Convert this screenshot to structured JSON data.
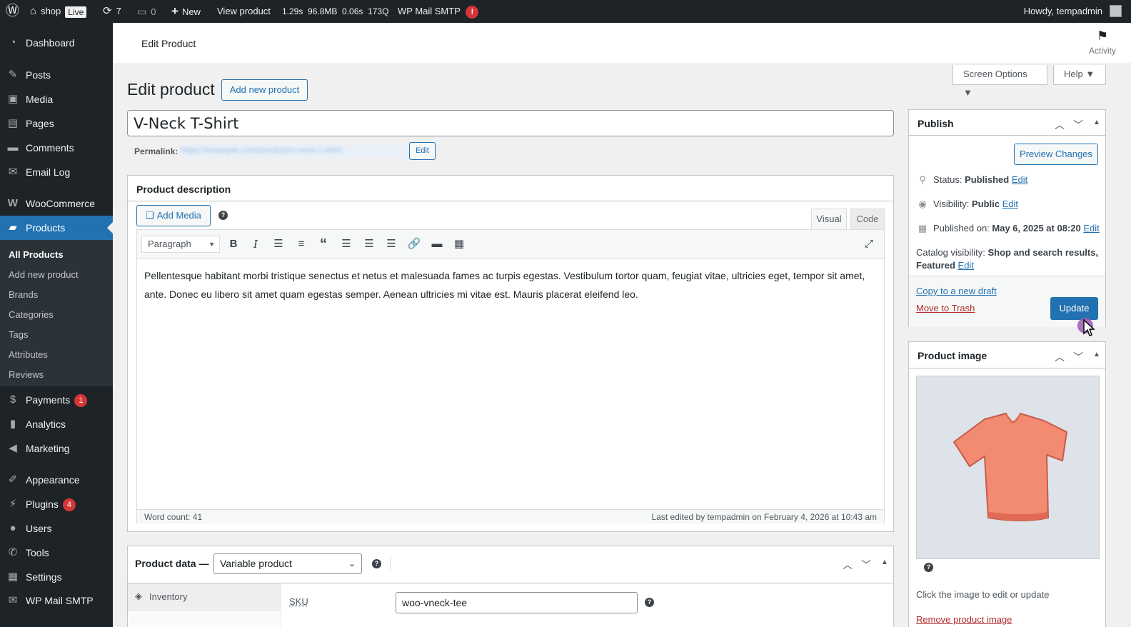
{
  "adminbar": {
    "site_name": "shop",
    "live_badge": "Live",
    "updates_count": "7",
    "comments_count": "0",
    "new_label": "New",
    "view_product": "View product",
    "perf": "1.29s  96.8MB  0.06s  173Q",
    "mail_smtp": "WP Mail SMTP",
    "mail_alert": "!",
    "howdy": "Howdy, tempadmin"
  },
  "sidebar": {
    "items": [
      {
        "label": "Dashboard",
        "icon": "dashboard-icon"
      },
      {
        "label": "Posts",
        "icon": "pin-icon"
      },
      {
        "label": "Media",
        "icon": "media-icon"
      },
      {
        "label": "Pages",
        "icon": "pages-icon"
      },
      {
        "label": "Comments",
        "icon": "comment-icon"
      },
      {
        "label": "Email Log",
        "icon": "envelope-icon"
      },
      {
        "label": "WooCommerce",
        "icon": "woo-icon"
      },
      {
        "label": "Products",
        "icon": "products-icon"
      },
      {
        "label": "Payments",
        "icon": "payments-icon",
        "badge": "1"
      },
      {
        "label": "Analytics",
        "icon": "analytics-icon"
      },
      {
        "label": "Marketing",
        "icon": "megaphone-icon"
      },
      {
        "label": "Appearance",
        "icon": "brush-icon"
      },
      {
        "label": "Plugins",
        "icon": "plug-icon",
        "badge": "4"
      },
      {
        "label": "Users",
        "icon": "user-icon"
      },
      {
        "label": "Tools",
        "icon": "wrench-icon"
      },
      {
        "label": "Settings",
        "icon": "settings-icon"
      },
      {
        "label": "WP Mail SMTP",
        "icon": "smtp-icon"
      }
    ],
    "submenu": [
      "All Products",
      "Add new product",
      "Brands",
      "Categories",
      "Tags",
      "Attributes",
      "Reviews"
    ]
  },
  "header": {
    "title": "Edit Product",
    "activity": "Activity",
    "screen_options": "Screen Options ▼",
    "help": "Help ▼"
  },
  "page": {
    "heading": "Edit product",
    "add_new": "Add new product",
    "product_title": "V-Neck T-Shirt",
    "permalink_label": "Permalink:",
    "permalink_url": "https://example.com/product/v-neck-t-shirt/",
    "permalink_edit": "Edit"
  },
  "description": {
    "title": "Product description",
    "add_media": "Add Media",
    "tab_visual": "Visual",
    "tab_code": "Code",
    "format": "Paragraph",
    "content": "Pellentesque habitant morbi tristique senectus et netus et malesuada fames ac turpis egestas. Vestibulum tortor quam, feugiat vitae, ultricies eget, tempor sit amet, ante. Donec eu libero sit amet quam egestas semper. Aenean ultricies mi vitae est. Mauris placerat eleifend leo.",
    "word_count": "Word count: 41",
    "last_edited": "Last edited by tempadmin on February 4, 2026 at 10:43 am"
  },
  "product_data": {
    "title": "Product data —",
    "type": "Variable product",
    "tab_inventory": "Inventory",
    "sku_label": "SKU",
    "sku_value": "woo-vneck-tee"
  },
  "publish": {
    "title": "Publish",
    "preview": "Preview Changes",
    "status_label": "Status:",
    "status_value": "Published",
    "visibility_label": "Visibility:",
    "visibility_value": "Public",
    "published_label": "Published on:",
    "published_value": "May 6, 2025 at 08:20",
    "catalog_label": "Catalog visibility:",
    "catalog_value": "Shop and search results, Featured",
    "edit": "Edit",
    "copy_draft": "Copy to a new draft",
    "trash": "Move to Trash",
    "update": "Update"
  },
  "product_image": {
    "title": "Product image",
    "hint": "Click the image to edit or update",
    "remove": "Remove product image"
  },
  "colors": {
    "admin_dark": "#1d2327",
    "accent": "#2271b1",
    "alert": "#d63638",
    "shirt": "#f28b72"
  }
}
